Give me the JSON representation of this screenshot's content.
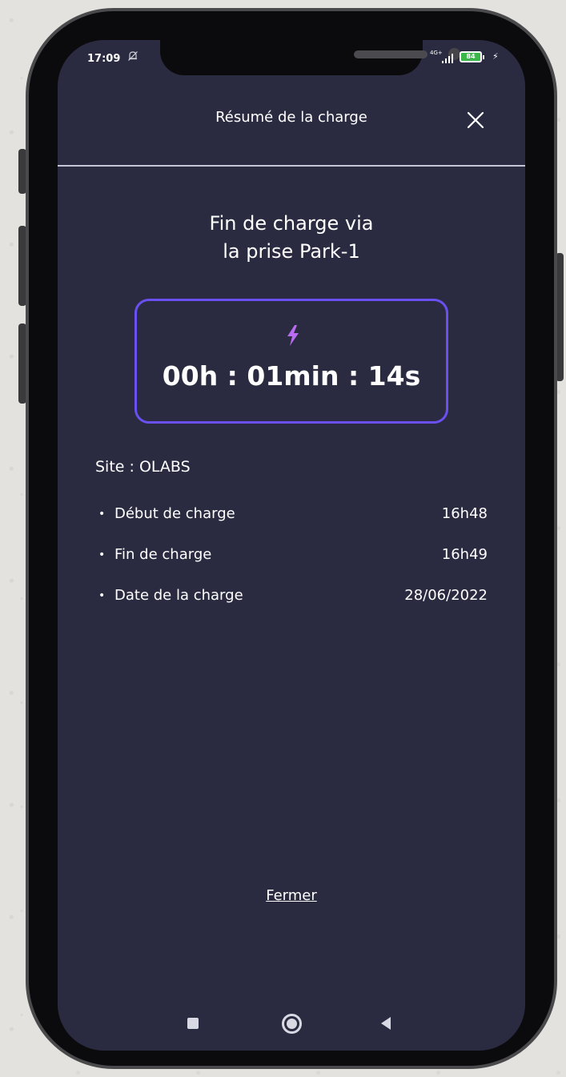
{
  "status_bar": {
    "time": "17:09",
    "mute_icon": "bell-off-icon",
    "network": "4G+",
    "battery_level": "84"
  },
  "header": {
    "title": "Résumé de la charge",
    "close_icon": "close-icon"
  },
  "main": {
    "title_line1": "Fin de charge via",
    "title_line2": "la prise Park-1",
    "timer_icon": "lightning-bolt-icon",
    "duration": "00h : 01min : 14s",
    "site": "Site : OLABS",
    "details": [
      {
        "label": "Début de charge",
        "value": "16h48"
      },
      {
        "label": "Fin de charge",
        "value": "16h49"
      },
      {
        "label": "Date de la charge",
        "value": "28/06/2022"
      }
    ]
  },
  "footer": {
    "close_link": "Fermer"
  },
  "colors": {
    "background": "#2a2b41",
    "accent_border": "#6a50f0",
    "bolt": "#b96cf0",
    "text": "#ffffff"
  }
}
